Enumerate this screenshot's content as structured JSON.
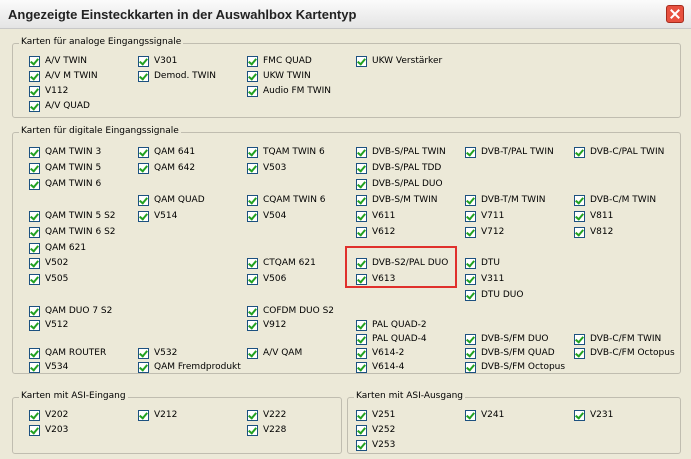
{
  "title": "Angezeigte Einsteckkarten in der Auswahlbox Kartentyp",
  "icons": {
    "close": "close-icon"
  },
  "accent_colors": {
    "checkmark": "#21a121",
    "highlight": "#e0302c",
    "close_button": "#e8503f"
  },
  "groups": {
    "analog": {
      "label": "Karten für analoge Eingangssignale",
      "items": [
        "A/V TWIN",
        "V301",
        "FMC QUAD",
        "UKW Verstärker",
        "A/V M TWIN",
        "Demod. TWIN",
        "UKW TWIN",
        "V112",
        "Audio FM TWIN",
        "A/V QUAD"
      ]
    },
    "digital": {
      "label": "Karten für digitale Eingangssignale",
      "items": [
        "QAM TWIN 3",
        "QAM 641",
        "TQAM TWIN 6",
        "DVB-S/PAL TWIN",
        "DVB-T/PAL TWIN",
        "DVB-C/PAL TWIN",
        "QAM TWIN 5",
        "QAM 642",
        "V503",
        "DVB-S/PAL TDD",
        "QAM TWIN 6",
        "DVB-S/PAL DUO",
        "QAM QUAD",
        "CQAM TWIN 6",
        "DVB-S/M TWIN",
        "DVB-T/M TWIN",
        "DVB-C/M TWIN",
        "QAM TWIN 5 S2",
        "V514",
        "V504",
        "V611",
        "V711",
        "V811",
        "QAM TWIN 6 S2",
        "V612",
        "V712",
        "V812",
        "QAM 621",
        "V502",
        "CTQAM 621",
        "DVB-S2/PAL DUO",
        "DTU",
        "V505",
        "V506",
        "V613",
        "V311",
        "DTU DUO",
        "QAM DUO 7 S2",
        "COFDM DUO S2",
        "V512",
        "V912",
        "PAL QUAD-2",
        "PAL QUAD-4",
        "DVB-S/FM DUO",
        "DVB-C/FM TWIN",
        "QAM ROUTER",
        "V532",
        "A/V QAM",
        "V614-2",
        "DVB-S/FM QUAD",
        "DVB-C/FM Octopus",
        "V534",
        "QAM Fremdprodukt",
        "V614-4",
        "DVB-S/FM Octopus"
      ]
    },
    "asi_in": {
      "label": "Karten mit ASI-Eingang",
      "items": [
        "V202",
        "V212",
        "V222",
        "V203",
        "V228"
      ]
    },
    "asi_out": {
      "label": "Karten mit ASI-Ausgang",
      "items": [
        "V251",
        "V241",
        "V231",
        "V252",
        "V253"
      ]
    }
  }
}
